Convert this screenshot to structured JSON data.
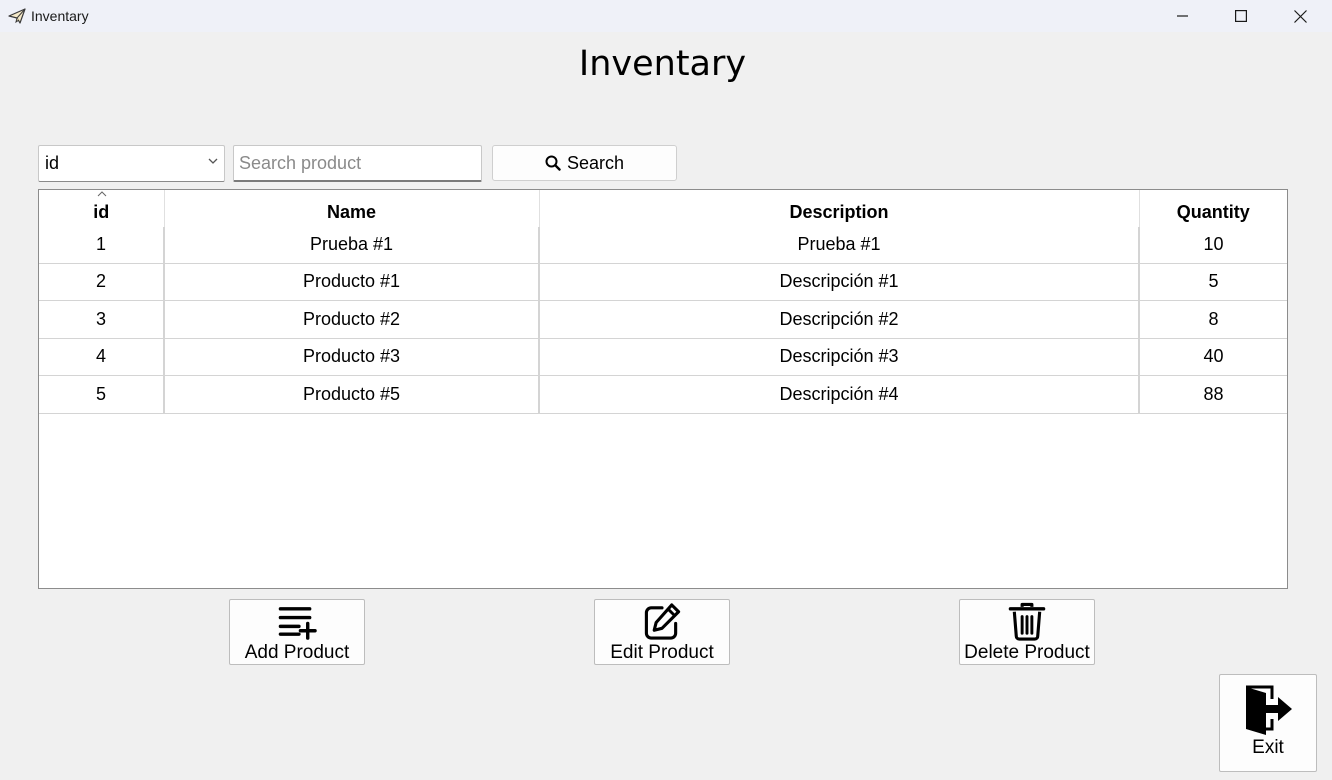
{
  "window": {
    "title": "Inventary",
    "controls": [
      "minimize-icon",
      "maximize-icon",
      "close-icon"
    ]
  },
  "heading": "Inventary",
  "search": {
    "filter_value": "id",
    "placeholder": "Search product",
    "button_label": "Search"
  },
  "table": {
    "columns": [
      "id",
      "Name",
      "Description",
      "Quantity"
    ],
    "rows": [
      [
        "1",
        "Prueba #1",
        "Prueba #1",
        "10"
      ],
      [
        "2",
        "Producto #1",
        "Descripción #1",
        "5"
      ],
      [
        "3",
        "Producto #2",
        "Descripción #2",
        "8"
      ],
      [
        "4",
        "Producto #3",
        "Descripción #3",
        "40"
      ],
      [
        "5",
        "Producto #5",
        "Descripción #4",
        "88"
      ]
    ]
  },
  "actions": {
    "add": "Add Product",
    "edit": "Edit Product",
    "delete": "Delete Product",
    "exit": "Exit"
  }
}
